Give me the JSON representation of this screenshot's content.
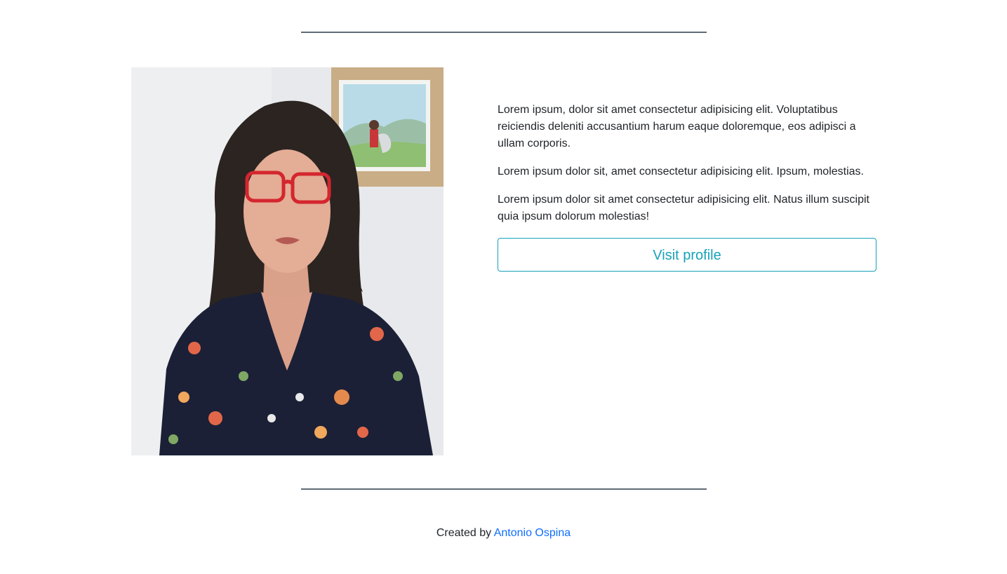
{
  "profile": {
    "photo_alt": "",
    "paragraphs": [
      "Lorem ipsum, dolor sit amet consectetur adipisicing elit. Voluptatibus reiciendis deleniti accusantium harum eaque doloremque, eos adipisci a ullam corporis.",
      "Lorem ipsum dolor sit, amet consectetur adipisicing elit. Ipsum, molestias.",
      "Lorem ipsum dolor sit amet consectetur adipisicing elit. Natus illum suscipit quia ipsum dolorum molestias!"
    ],
    "visit_button_label": "Visit profile"
  },
  "footer": {
    "prefix": "Created by",
    "author_link": "Antonio Ospina"
  },
  "colors": {
    "accent": "#17a2b8",
    "link": "#0d6efd",
    "rule": "#5f6b76",
    "text": "#212529"
  }
}
